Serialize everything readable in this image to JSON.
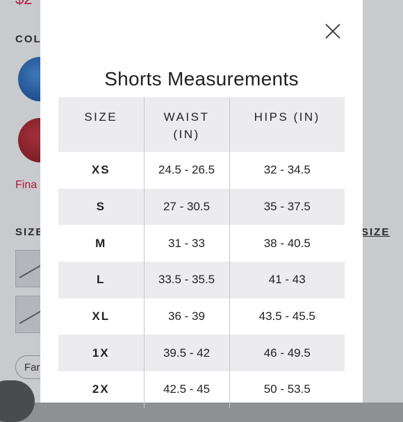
{
  "background": {
    "price": "$2",
    "color_label": "COL",
    "fina_text": "Fina",
    "size_label": "SIZE",
    "size_link": "SIZE",
    "chip_label": "Far"
  },
  "modal": {
    "title": "Shorts Measurements",
    "close_icon": "close-icon",
    "columns": [
      "SIZE",
      "WAIST (IN)",
      "HIPS (IN)"
    ],
    "rows": [
      {
        "size": "XS",
        "waist": "24.5 - 26.5",
        "hips": "32 - 34.5"
      },
      {
        "size": "S",
        "waist": "27 - 30.5",
        "hips": "35 - 37.5"
      },
      {
        "size": "M",
        "waist": "31 - 33",
        "hips": "38 - 40.5"
      },
      {
        "size": "L",
        "waist": "33.5 - 35.5",
        "hips": "41 - 43"
      },
      {
        "size": "XL",
        "waist": "36 - 39",
        "hips": "43.5 - 45.5"
      },
      {
        "size": "1X",
        "waist": "39.5 - 42",
        "hips": "46 - 49.5"
      },
      {
        "size": "2X",
        "waist": "42.5 - 45",
        "hips": "50 - 53.5"
      }
    ]
  },
  "colors": {
    "accent": "#b01a3c",
    "stripe": "#ececee",
    "overlay": "#c9cacd"
  }
}
